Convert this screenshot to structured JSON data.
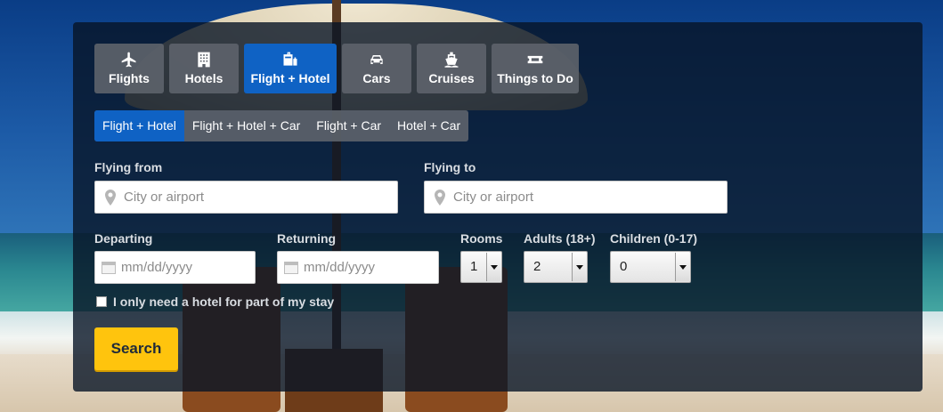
{
  "tabs": [
    {
      "label": "Flights",
      "icon": "plane-icon",
      "active": false
    },
    {
      "label": "Hotels",
      "icon": "building-icon",
      "active": false
    },
    {
      "label": "Flight + Hotel",
      "icon": "luggage-icon",
      "active": true
    },
    {
      "label": "Cars",
      "icon": "car-icon",
      "active": false
    },
    {
      "label": "Cruises",
      "icon": "ship-icon",
      "active": false
    },
    {
      "label": "Things to Do",
      "icon": "ticket-icon",
      "active": false
    }
  ],
  "subtabs": [
    {
      "label": "Flight + Hotel",
      "active": true
    },
    {
      "label": "Flight + Hotel + Car",
      "active": false
    },
    {
      "label": "Flight + Car",
      "active": false
    },
    {
      "label": "Hotel + Car",
      "active": false
    }
  ],
  "form": {
    "flying_from": {
      "label": "Flying from",
      "placeholder": "City or airport",
      "value": ""
    },
    "flying_to": {
      "label": "Flying to",
      "placeholder": "City or airport",
      "value": ""
    },
    "departing": {
      "label": "Departing",
      "placeholder": "mm/dd/yyyy",
      "value": ""
    },
    "returning": {
      "label": "Returning",
      "placeholder": "mm/dd/yyyy",
      "value": ""
    },
    "rooms": {
      "label": "Rooms",
      "value": "1"
    },
    "adults": {
      "label": "Adults (18+)",
      "value": "2"
    },
    "children": {
      "label": "Children (0-17)",
      "value": "0"
    },
    "partial_stay": {
      "label": "I only need a hotel for part of my stay",
      "checked": false
    },
    "search_label": "Search"
  },
  "colors": {
    "active_tab": "#0f62c4",
    "search_button": "#ffc40d"
  }
}
